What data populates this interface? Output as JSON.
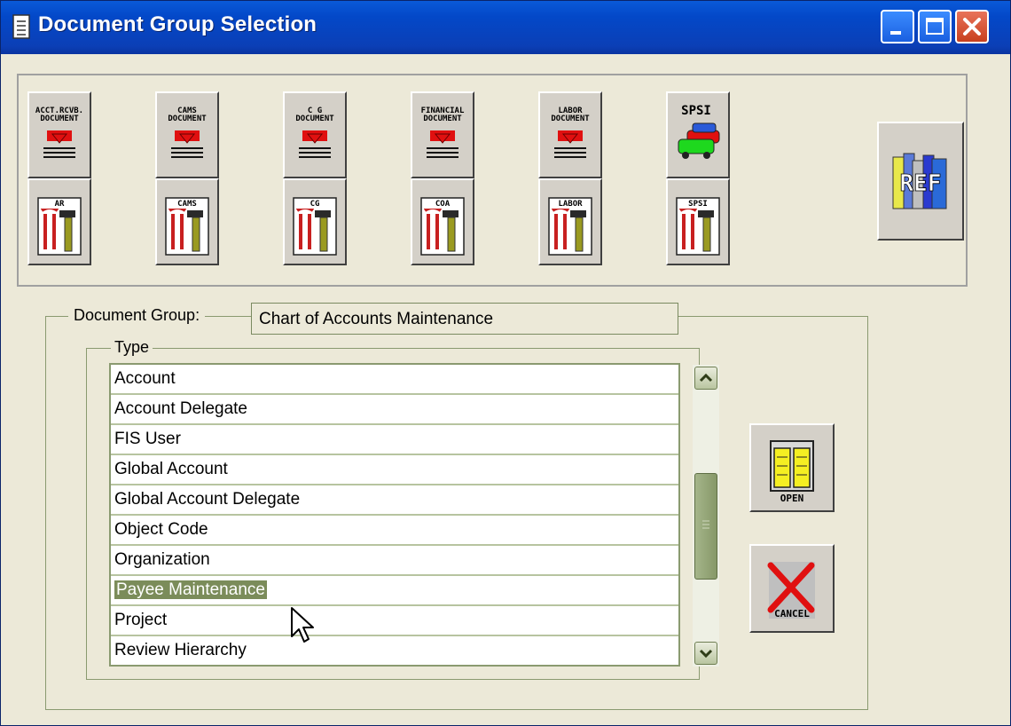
{
  "window": {
    "title": "Document Group Selection",
    "controls": {
      "minimize": "minimize-icon",
      "maximize": "maximize-icon",
      "close": "close-icon"
    }
  },
  "toolbar": {
    "documents": [
      {
        "label": "ACCT.RCVB. DOCUMENT",
        "icon": "document-download-icon"
      },
      {
        "label": "CAMS DOCUMENT",
        "icon": "document-download-icon"
      },
      {
        "label": "C G DOCUMENT",
        "icon": "document-download-icon"
      },
      {
        "label": "FINANCIAL DOCUMENT",
        "icon": "document-download-icon"
      },
      {
        "label": "LABOR DOCUMENT",
        "icon": "document-download-icon"
      },
      {
        "label": "SPSI",
        "icon": "cars-icon"
      }
    ],
    "tools": [
      {
        "label": "AR",
        "icon": "tools-icon"
      },
      {
        "label": "CAMS",
        "icon": "tools-icon"
      },
      {
        "label": "CG",
        "icon": "tools-icon"
      },
      {
        "label": "COA",
        "icon": "tools-icon"
      },
      {
        "label": "LABOR",
        "icon": "tools-icon"
      },
      {
        "label": "SPSI",
        "icon": "tools-icon"
      }
    ],
    "ref_label": "REF"
  },
  "document_group": {
    "label": "Document Group:",
    "value": "Chart of Accounts Maintenance"
  },
  "type": {
    "label": "Type",
    "items": [
      "Account",
      "Account Delegate",
      "FIS User",
      "Global Account",
      "Global Account Delegate",
      "Object Code",
      "Organization",
      "Payee Maintenance",
      "Project",
      "Review Hierarchy"
    ],
    "selected": "Payee Maintenance"
  },
  "actions": {
    "open_label": "OPEN",
    "cancel_label": "CANCEL"
  },
  "colors": {
    "title_bar": "#0b3fb6",
    "window_bg": "#ece9d8",
    "selection": "#7b8c5a",
    "cancel_x": "#e01010"
  }
}
